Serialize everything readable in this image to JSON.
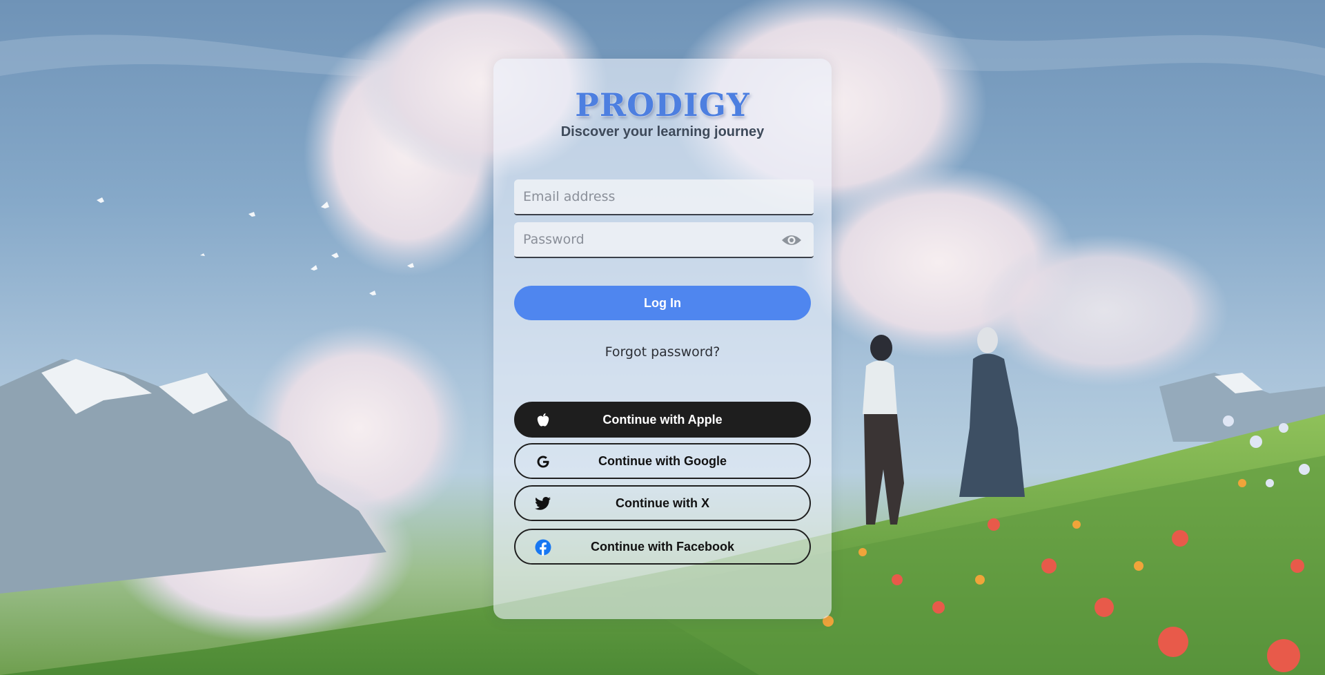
{
  "brand": {
    "name": "PRODIGY",
    "tagline": "Discover your learning journey"
  },
  "login_form": {
    "email_placeholder": "Email address",
    "email_value": "",
    "password_placeholder": "Password",
    "password_value": "",
    "login_label": "Log In",
    "forgot_label": "Forgot password?"
  },
  "social_logins": {
    "apple": {
      "label": "Continue with Apple",
      "icon": "apple-icon"
    },
    "google": {
      "label": "Continue with Google",
      "icon": "google-icon"
    },
    "x": {
      "label": "Continue with X",
      "icon": "twitter-bird-icon"
    },
    "facebook": {
      "label": "Continue with Facebook",
      "icon": "facebook-icon"
    }
  },
  "colors": {
    "brand": "#4d7fe0",
    "primary_button": "#4f86ef",
    "apple_button": "#1e1e1e",
    "facebook_blue": "#1877f2"
  }
}
